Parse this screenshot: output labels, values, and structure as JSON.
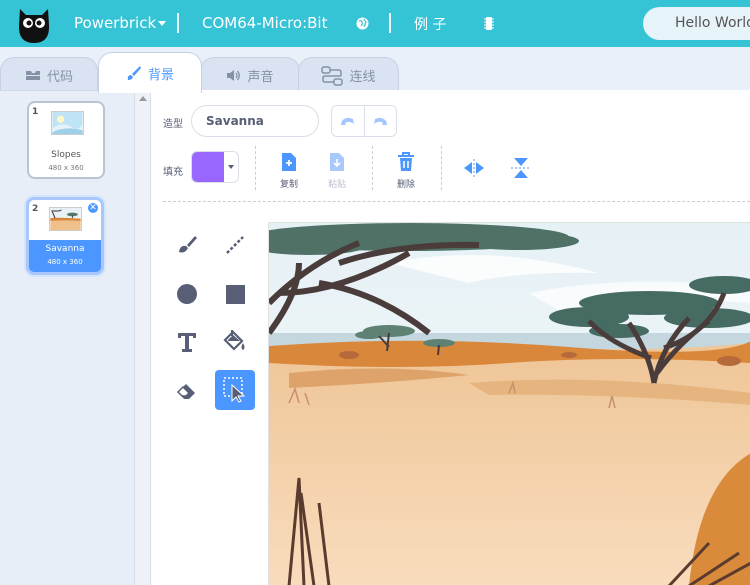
{
  "menubar": {
    "device_label": "Powerbrick",
    "port_label": "COM64-Micro:Bit",
    "examples_label": "例 子",
    "hello_label": "Hello World"
  },
  "tabs": [
    {
      "label": "代码",
      "icon": "code-icon"
    },
    {
      "label": "背景",
      "icon": "brush-icon"
    },
    {
      "label": "声音",
      "icon": "sound-icon"
    },
    {
      "label": "连线",
      "icon": "wiring-icon"
    }
  ],
  "costumes": [
    {
      "number": "1",
      "name": "Slopes",
      "dims": "480 x 360"
    },
    {
      "number": "2",
      "name": "Savanna",
      "dims": "480 x 360"
    }
  ],
  "editor": {
    "costume_label": "造型",
    "costume_name": "Savanna",
    "fill_label": "填充",
    "fill_color": "#9966ff",
    "copy_label": "复制",
    "paste_label": "粘贴",
    "delete_label": "删除"
  },
  "colors": {
    "menubar": "#35c3d6",
    "accent": "#4c97ff"
  }
}
